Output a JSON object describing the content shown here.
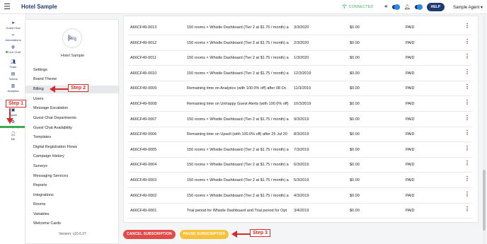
{
  "app": {
    "title": "Hotel Sample"
  },
  "topbar": {
    "connection_status": "CONNECTED",
    "help_label": "HELP",
    "agent_name": "Sample Agent"
  },
  "rail": {
    "items": [
      {
        "icon": "send-icon",
        "label": "Guest Chat"
      },
      {
        "icon": "code-icon",
        "label": "Automations"
      },
      {
        "icon": "globe-icon",
        "label": "Live Chat"
      },
      {
        "icon": "users-icon",
        "label": "Team"
      },
      {
        "icon": "ticket-icon",
        "label": "Tickets"
      },
      {
        "icon": "chart-icon",
        "label": "Analytics"
      },
      {
        "icon": "upsell-icon",
        "label": "Upsell"
      },
      {
        "icon": "gear-icon",
        "label": "Company"
      },
      {
        "icon": "person-icon",
        "label": "Me"
      }
    ]
  },
  "panel": {
    "hotel_name": "Hotel Sample",
    "menu": [
      "Settings",
      "Brand Theme",
      "Billing",
      "Users",
      "Message Escalation",
      "Guest Chat Departments",
      "Guest Chat Availability",
      "Templates",
      "Digital Registration Flows",
      "Campaign History",
      "Surveys",
      "Messaging Services",
      "Reports",
      "Integrations",
      "Rooms",
      "Variables",
      "Welcome Cards"
    ],
    "active_item": "Billing",
    "version": "Version: v10.6.27"
  },
  "steps": {
    "step1": "Step 1",
    "step2": "Step 2",
    "step3": "Step 3"
  },
  "invoices": [
    {
      "id": "A66CF49-0013",
      "desc": "150 rooms × Whistle Dashboard (Tier 2 at $1.75 / month) a",
      "date": "3/3/2020",
      "amount": "$0.00",
      "status": "PAID"
    },
    {
      "id": "A66CF49-0012",
      "desc": "150 rooms × Whistle Dashboard (Tier 2 at $1.75 / month) a",
      "date": "2/3/2020",
      "amount": "$0.00",
      "status": "PAID"
    },
    {
      "id": "A66CF49-0011",
      "desc": "150 rooms × Whistle Dashboard (Tier 2 at $1.75 / month) a",
      "date": "1/3/2020",
      "amount": "$0.00",
      "status": "PAID"
    },
    {
      "id": "A66CF49-0010",
      "desc": "150 rooms × Whistle Dashboard (Tier 2 at $1.75 / month) a",
      "date": "12/3/2019",
      "amount": "$0.00",
      "status": "PAID"
    },
    {
      "id": "A66CF49-0009",
      "desc": "Remaining time on Analytics (with 100.0% off) after 08 Oc",
      "date": "11/3/2019",
      "amount": "$0.00",
      "status": "PAID"
    },
    {
      "id": "A66CF49-0008",
      "desc": "Remaining time on Unhappy Guest Alerts (with 100.0% off)",
      "date": "10/3/2019",
      "amount": "$0.00",
      "status": "PAID"
    },
    {
      "id": "A66CF49-0007",
      "desc": "150 rooms × Whistle Dashboard (Tier 2 at $1.75 / month) a",
      "date": "9/3/2019",
      "amount": "$0.00",
      "status": "PAID"
    },
    {
      "id": "A66CF49-0006",
      "desc": "Remaining time on Upsell (with 100.0% off) after 25 Jul 20",
      "date": "8/3/2019",
      "amount": "$0.00",
      "status": "PAID"
    },
    {
      "id": "A66CF49-0005",
      "desc": "150 rooms × Whistle Dashboard (Tier 2 at $1.75 / month) a",
      "date": "7/3/2019",
      "amount": "$0.00",
      "status": "PAID"
    },
    {
      "id": "A66CF49-0004",
      "desc": "150 rooms × Whistle Dashboard (Tier 2 at $1.75 / month) a",
      "date": "6/3/2019",
      "amount": "$0.00",
      "status": "PAID"
    },
    {
      "id": "A66CF49-0003",
      "desc": "150 rooms × Whistle Dashboard (Tier 2 at $1.75 / month) a",
      "date": "5/3/2019",
      "amount": "$0.00",
      "status": "PAID"
    },
    {
      "id": "A66CF49-0002",
      "desc": "150 rooms × Whistle Dashboard (Tier 2 at $1.75 / month) a",
      "date": "4/3/2019",
      "amount": "$0.00",
      "status": "PAID"
    },
    {
      "id": "A66CF49-0001",
      "desc": "Trial period for Whistle Dashboard and Trial period for Opt",
      "date": "3/4/2019",
      "amount": "$0.00",
      "status": "PAID"
    }
  ],
  "actions": {
    "cancel_label": "CANCEL SUBSCRIPTION",
    "pause_label": "PAUSE SUBSCRIPTION"
  },
  "colors": {
    "brand": "#1f3a6e",
    "connected": "#3caa55",
    "cancel": "#e34a4a",
    "pause": "#f7c23a",
    "callout": "#d42b2b"
  }
}
